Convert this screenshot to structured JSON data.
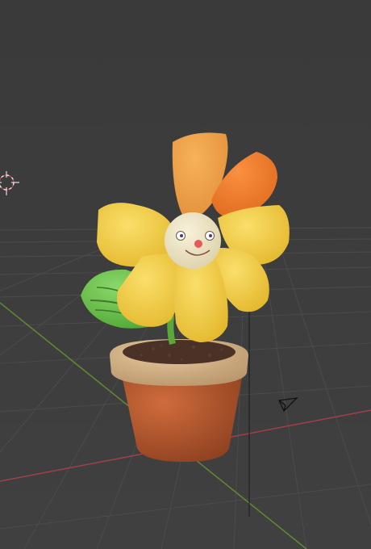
{
  "viewport": {
    "background_top": "#3a3a3a",
    "background_bottom": "#404040",
    "grid_color": "#4a4a4a",
    "x_axis_color": "#a04048",
    "y_axis_color": "#5f8a30"
  },
  "objects": {
    "flower_pot": {
      "pot_color": "#b85a30",
      "rim_color": "#d6b48a",
      "soil_color": "#4a3226"
    },
    "flower_head": {
      "face_color": "#eee6c6",
      "nose_color": "#e85a5a"
    },
    "petals": {
      "yellow": "#f4cc3c",
      "orange_light": "#f0a048",
      "orange_dark": "#f07828"
    },
    "leaf": {
      "color": "#6cc44c"
    }
  },
  "gizmos": {
    "cursor_3d": "3d-cursor-icon",
    "light": "point-light-icon",
    "camera": "camera-icon"
  }
}
